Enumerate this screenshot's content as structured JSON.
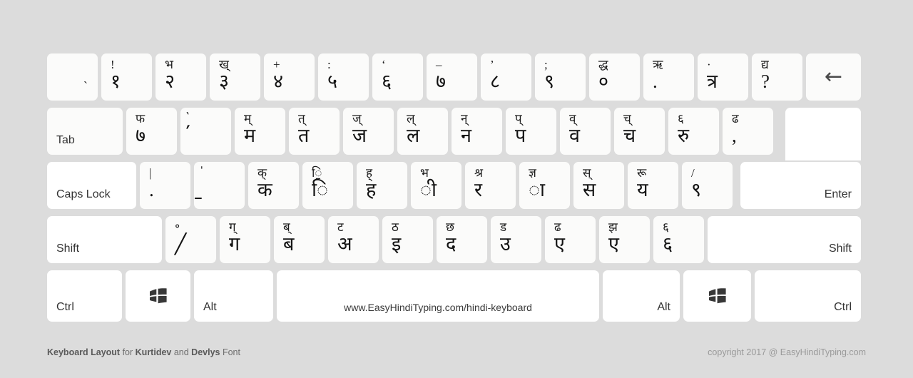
{
  "meta": {
    "background_color": "#dcdcdc",
    "key_color": "#fbfbfa",
    "modifier_key_color": "#ffffff"
  },
  "rows": {
    "number_row": [
      {
        "name": "key-backtick",
        "top": "",
        "main": "",
        "solo": "`"
      },
      {
        "name": "key-1",
        "top": "!",
        "main": "१"
      },
      {
        "name": "key-2",
        "top": "भ",
        "main": "२"
      },
      {
        "name": "key-3",
        "top": "ख्",
        "main": "३"
      },
      {
        "name": "key-4",
        "top": "+",
        "main": "४"
      },
      {
        "name": "key-5",
        "top": ":",
        "main": "५"
      },
      {
        "name": "key-6",
        "top": "‘",
        "main": "६"
      },
      {
        "name": "key-7",
        "top": "–",
        "main": "७"
      },
      {
        "name": "key-8",
        "top": "’",
        "main": "८"
      },
      {
        "name": "key-9",
        "top": ";",
        "main": "९"
      },
      {
        "name": "key-0",
        "top": "द्ध",
        "main": "०"
      },
      {
        "name": "key-minus",
        "top": "ऋ",
        "main": "."
      },
      {
        "name": "key-equal",
        "top": "·",
        "main": "त्र"
      },
      {
        "name": "key-bracket-right-alt",
        "top": "द्य",
        "main": "?"
      }
    ],
    "backspace": {
      "name": "key-backspace",
      "icon": "arrow-left-icon",
      "glyph": "←"
    },
    "tab_row": [
      {
        "name": "key-q",
        "top": "फ",
        "main": "७"
      },
      {
        "name": "key-w",
        "top": "॓",
        "main": "॔"
      },
      {
        "name": "key-e",
        "top": "म्",
        "main": "म"
      },
      {
        "name": "key-r",
        "top": "त्",
        "main": "त"
      },
      {
        "name": "key-t",
        "top": "ज्",
        "main": "ज"
      },
      {
        "name": "key-y",
        "top": "ल्",
        "main": "ल"
      },
      {
        "name": "key-u",
        "top": "न्",
        "main": "न"
      },
      {
        "name": "key-i",
        "top": "प्",
        "main": "प"
      },
      {
        "name": "key-o",
        "top": "व्",
        "main": "व"
      },
      {
        "name": "key-p",
        "top": "च्",
        "main": "च"
      },
      {
        "name": "key-bracket-left",
        "top": "६",
        "main": "रु"
      },
      {
        "name": "key-bracket-right",
        "top": "ढ",
        "main": ","
      }
    ],
    "tab": {
      "name": "key-tab",
      "label": "Tab"
    },
    "home_row": [
      {
        "name": "key-a",
        "top": "|",
        "main": "."
      },
      {
        "name": "key-s",
        "top": "॑",
        "main": "॒"
      },
      {
        "name": "key-d",
        "top": "क्",
        "main": "क"
      },
      {
        "name": "key-f",
        "top": "ि॒",
        "main": "ि"
      },
      {
        "name": "key-g",
        "top": "ह्",
        "main": "ह"
      },
      {
        "name": "key-h",
        "top": "भ",
        "main": "ी"
      },
      {
        "name": "key-j",
        "top": "श्र",
        "main": "र"
      },
      {
        "name": "key-k",
        "top": "ज्ञ",
        "main": "ा"
      },
      {
        "name": "key-l",
        "top": "स्",
        "main": "स"
      },
      {
        "name": "key-semicolon",
        "top": "रू",
        "main": "य"
      },
      {
        "name": "key-quote",
        "top": "/",
        "main": "९"
      }
    ],
    "capslock": {
      "name": "key-caps-lock",
      "label": "Caps Lock"
    },
    "enter": {
      "name": "key-enter",
      "label": "Enter"
    },
    "shift_row": [
      {
        "name": "key-backslash",
        "top": "॰",
        "main": "╱"
      },
      {
        "name": "key-z",
        "top": "ग्",
        "main": "ग"
      },
      {
        "name": "key-x",
        "top": "ब्",
        "main": "ब"
      },
      {
        "name": "key-c",
        "top": "ट",
        "main": "अ"
      },
      {
        "name": "key-v",
        "top": "ठ",
        "main": "इ"
      },
      {
        "name": "key-b",
        "top": "छ",
        "main": "द"
      },
      {
        "name": "key-n",
        "top": "ड",
        "main": "उ"
      },
      {
        "name": "key-m",
        "top": "ढ",
        "main": "ए"
      },
      {
        "name": "key-comma",
        "top": "झ",
        "main": "ए"
      },
      {
        "name": "key-period",
        "top": "६",
        "main": "६"
      }
    ],
    "shift_left": {
      "name": "key-shift-left",
      "label": "Shift"
    },
    "shift_right": {
      "name": "key-shift-right",
      "label": "Shift"
    },
    "bottom_row": {
      "ctrl_left": {
        "name": "key-ctrl-left",
        "label": "Ctrl"
      },
      "win_left": {
        "name": "key-win-left",
        "icon": "windows-logo-icon"
      },
      "alt_left": {
        "name": "key-alt-left",
        "label": "Alt"
      },
      "space": {
        "name": "key-space",
        "label": "www.EasyHindiTyping.com/hindi-keyboard"
      },
      "alt_right": {
        "name": "key-alt-right",
        "label": "Alt"
      },
      "win_right": {
        "name": "key-win-right",
        "icon": "windows-logo-icon"
      },
      "ctrl_right": {
        "name": "key-ctrl-right",
        "label": "Ctrl"
      }
    }
  },
  "footer": {
    "left_bold_1": "Keyboard Layout",
    "left_plain_1": " for ",
    "left_bold_2": "Kurtidev",
    "left_plain_2": " and ",
    "left_bold_3": "Devlys",
    "left_plain_3": " Font",
    "right": "copyright 2017 @ EasyHindiTyping.com"
  }
}
